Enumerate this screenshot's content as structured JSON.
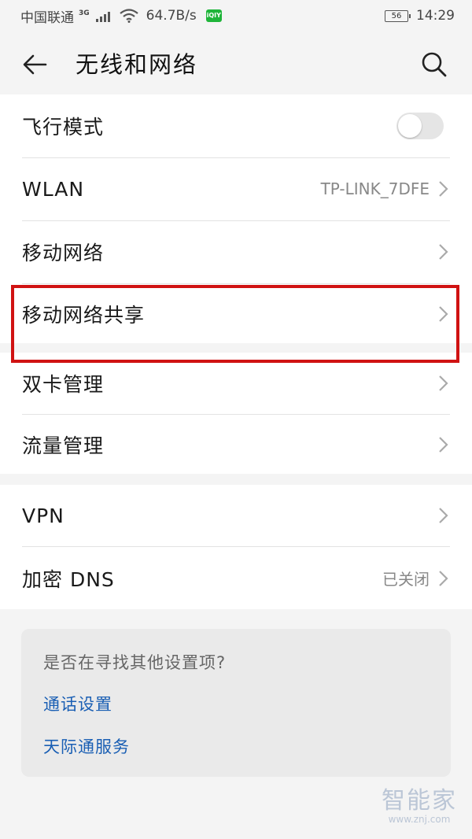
{
  "status_bar": {
    "carrier": "中国联通",
    "network_type": "3G",
    "speed": "64.7B/s",
    "app_badge": "iQIY",
    "battery_level": "56",
    "time": "14:29"
  },
  "header": {
    "title": "无线和网络",
    "back_icon": "arrow-left-icon",
    "search_icon": "search-icon"
  },
  "group1": [
    {
      "label": "飞行模式",
      "type": "toggle",
      "on": false
    },
    {
      "label": "WLAN",
      "type": "link",
      "value": "TP-LINK_7DFE"
    },
    {
      "label": "移动网络",
      "type": "link",
      "value": ""
    },
    {
      "label": "移动网络共享",
      "type": "link",
      "value": ""
    }
  ],
  "group2": [
    {
      "label": "双卡管理",
      "type": "link",
      "value": ""
    },
    {
      "label": "流量管理",
      "type": "link",
      "value": ""
    }
  ],
  "group3": [
    {
      "label": "VPN",
      "type": "link",
      "value": ""
    },
    {
      "label": "加密 DNS",
      "type": "link",
      "value": "已关闭"
    }
  ],
  "suggest": {
    "question": "是否在寻找其他设置项?",
    "links": [
      "通话设置",
      "天际通服务"
    ]
  },
  "watermark": {
    "brand": "智能家",
    "url": "www.znj.com"
  },
  "colors": {
    "highlight": "#d01212",
    "link": "#1a5fb4",
    "background": "#f4f4f4"
  }
}
